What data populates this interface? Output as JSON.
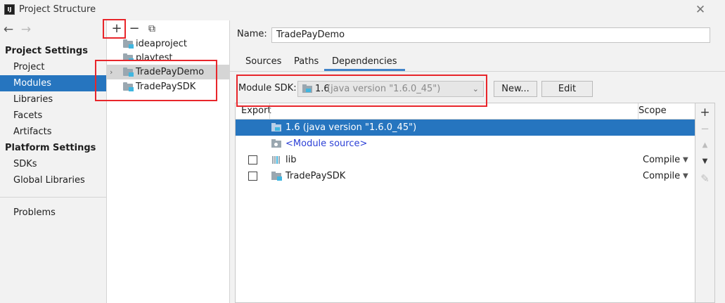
{
  "window": {
    "title": "Project Structure",
    "logo_text": "IJ",
    "close_glyph": "✕"
  },
  "nav": {
    "back_glyph": "←",
    "forward_glyph": "→",
    "project_settings_heading": "Project Settings",
    "project_settings_items": [
      "Project",
      "Modules",
      "Libraries",
      "Facets",
      "Artifacts"
    ],
    "platform_settings_heading": "Platform Settings",
    "platform_settings_items": [
      "SDKs",
      "Global Libraries"
    ],
    "problems_label": "Problems",
    "selected_item": "Modules"
  },
  "module_toolbar": {
    "add_glyph": "+",
    "remove_glyph": "−",
    "copy_glyph": "⧉"
  },
  "modules": [
    {
      "label": "ideaproject",
      "expandable": false
    },
    {
      "label": "playtest",
      "expandable": false
    },
    {
      "label": "TradePayDemo",
      "expandable": true,
      "chevron": "›",
      "selected": true
    },
    {
      "label": "TradePaySDK",
      "expandable": false
    }
  ],
  "module_detail": {
    "name_label": "Name:",
    "name_value": "TradePayDemo",
    "tabs": [
      "Sources",
      "Paths",
      "Dependencies"
    ],
    "active_tab": "Dependencies",
    "sdk_label": "Module SDK:",
    "sdk_version": "1.6",
    "sdk_detail": "(java version \"1.6.0_45\")",
    "sdk_dropdown_glyph": "⌄",
    "new_button": "New...",
    "edit_button": "Edit"
  },
  "dependencies": {
    "columns": {
      "export": "Export",
      "scope": "Scope"
    },
    "rows": [
      {
        "label": "1.6 (java version \"1.6.0_45\")",
        "type": "sdk",
        "selected": true,
        "checkbox": false,
        "scope": ""
      },
      {
        "label": "<Module source>",
        "type": "module-source",
        "selected": false,
        "checkbox": false,
        "scope": ""
      },
      {
        "label": "lib",
        "type": "library",
        "selected": false,
        "checkbox": true,
        "checked": false,
        "scope": "Compile"
      },
      {
        "label": "TradePaySDK",
        "type": "module",
        "selected": false,
        "checkbox": true,
        "checked": false,
        "scope": "Compile"
      }
    ],
    "scope_arrow_glyph": "▼"
  },
  "side_toolbar": {
    "add_glyph": "+",
    "remove_glyph": "−",
    "up_glyph": "▲",
    "down_glyph": "▼",
    "edit_glyph": "✎"
  },
  "colors": {
    "selection": "#2675bf",
    "annotation_red": "#e8262b",
    "module_icon_accent": "#40b6e0",
    "link_blue": "#2b3fd6"
  }
}
